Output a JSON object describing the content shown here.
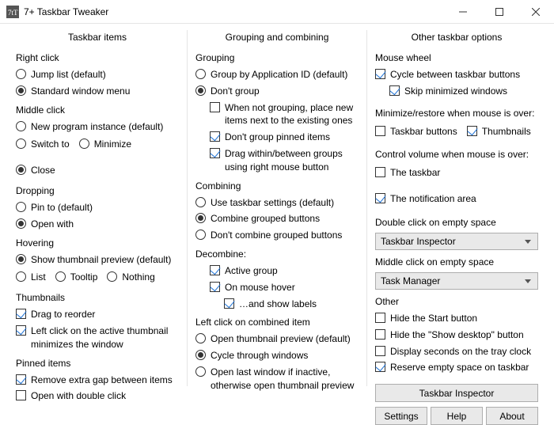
{
  "window": {
    "title": "7+ Taskbar Tweaker"
  },
  "columns": {
    "taskbar_items": {
      "header": "Taskbar items",
      "right_click": {
        "title": "Right click",
        "jump_list": "Jump list (default)",
        "standard_menu": "Standard window menu"
      },
      "middle_click": {
        "title": "Middle click",
        "new_instance": "New program instance (default)",
        "switch_to": "Switch to",
        "minimize": "Minimize",
        "close": "Close"
      },
      "dropping": {
        "title": "Dropping",
        "pin_to": "Pin to (default)",
        "open_with": "Open with"
      },
      "hovering": {
        "title": "Hovering",
        "thumb": "Show thumbnail preview (default)",
        "list": "List",
        "tooltip": "Tooltip",
        "nothing": "Nothing"
      },
      "thumbnails": {
        "title": "Thumbnails",
        "drag_reorder": "Drag to reorder",
        "left_click_min": "Left click on the active thumbnail minimizes the window"
      },
      "pinned": {
        "title": "Pinned items",
        "remove_gap": "Remove extra gap between items",
        "open_dbl": "Open with double click"
      }
    },
    "grouping": {
      "header": "Grouping and combining",
      "grouping": {
        "title": "Grouping",
        "by_appid": "Group by Application ID (default)",
        "dont_group": "Don't group",
        "place_next": "When not grouping, place new items next to the existing ones",
        "dont_group_pinned": "Don't group pinned items",
        "drag_between": "Drag within/between groups using right mouse button"
      },
      "combining": {
        "title": "Combining",
        "use_taskbar": "Use taskbar settings (default)",
        "combine_grouped": "Combine grouped buttons",
        "dont_combine": "Don't combine grouped buttons"
      },
      "decombine": {
        "title": "Decombine:",
        "active_group": "Active group",
        "on_hover": "On mouse hover",
        "show_labels": "…and show labels"
      },
      "left_click": {
        "title": "Left click on combined item",
        "open_thumb": "Open thumbnail preview (default)",
        "cycle": "Cycle through windows",
        "open_last": "Open last window if inactive, otherwise open thumbnail preview"
      }
    },
    "other": {
      "header": "Other taskbar options",
      "mouse_wheel": {
        "title": "Mouse wheel",
        "cycle": "Cycle between taskbar buttons",
        "skip_min": "Skip minimized windows"
      },
      "min_restore": {
        "title": "Minimize/restore when mouse is over:",
        "taskbar_buttons": "Taskbar buttons",
        "thumbnails": "Thumbnails"
      },
      "control_vol": {
        "title": "Control volume when mouse is over:",
        "the_taskbar": "The taskbar",
        "notif_area": "The notification area"
      },
      "dbl_click": {
        "title": "Double click on empty space",
        "value": "Taskbar Inspector"
      },
      "mid_click": {
        "title": "Middle click on empty space",
        "value": "Task Manager"
      },
      "other_group": {
        "title": "Other",
        "hide_start": "Hide the Start button",
        "hide_show_desktop": "Hide the \"Show desktop\" button",
        "tray_seconds": "Display seconds on the tray clock",
        "reserve_empty": "Reserve empty space on taskbar"
      },
      "buttons": {
        "inspector": "Taskbar Inspector",
        "settings": "Settings",
        "help": "Help",
        "about": "About"
      }
    }
  }
}
